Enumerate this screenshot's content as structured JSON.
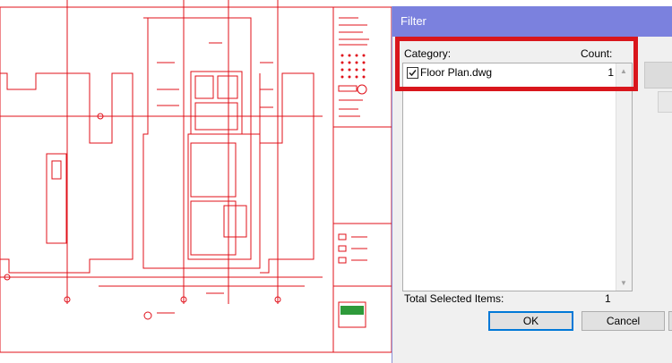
{
  "dialog": {
    "title": "Filter",
    "category_header": "Category:",
    "count_header": "Count:",
    "items": [
      {
        "label": "Floor Plan.dwg",
        "count": "1",
        "checked": true
      }
    ],
    "total_label": "Total Selected Items:",
    "total_value": "1",
    "ok_label": "OK",
    "cancel_label": "Cancel"
  },
  "colors": {
    "titlebar": "#7b81de",
    "highlight": "#d9161c",
    "drawing_lines": "#e0101a",
    "dialog_bg": "#f0f0f0"
  }
}
